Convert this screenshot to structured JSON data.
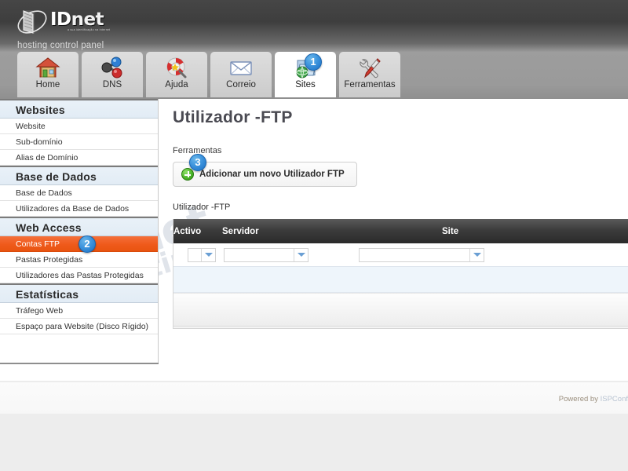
{
  "header": {
    "logo_text_1": "ID",
    "logo_text_2": "net",
    "logo_tagline": "a sua identificação na internet",
    "subtitle": "hosting control panel",
    "logo_icon": "idnet-swoosh-logo"
  },
  "tabs": [
    {
      "label": "Home",
      "icon": "house-icon",
      "active": false,
      "badge": ""
    },
    {
      "label": "DNS",
      "icon": "molecule-icon",
      "active": false,
      "badge": ""
    },
    {
      "label": "Ajuda",
      "icon": "lifering-magnifier-icon",
      "active": false,
      "badge": ""
    },
    {
      "label": "Correio",
      "icon": "envelope-icon",
      "active": false,
      "badge": ""
    },
    {
      "label": "Sites",
      "icon": "globe-folder-icon",
      "active": true,
      "badge": "1"
    },
    {
      "label": "Ferramentas",
      "icon": "wrench-screwdriver-icon",
      "active": false,
      "badge": ""
    }
  ],
  "sidebar": {
    "groups": [
      {
        "title": "Websites",
        "items": [
          {
            "label": "Website",
            "selected": false,
            "badge": ""
          },
          {
            "label": "Sub-domínio",
            "selected": false,
            "badge": ""
          },
          {
            "label": "Alias de Domínio",
            "selected": false,
            "badge": ""
          }
        ]
      },
      {
        "title": "Base de Dados",
        "items": [
          {
            "label": "Base de Dados",
            "selected": false,
            "badge": ""
          },
          {
            "label": "Utilizadores da Base de Dados",
            "selected": false,
            "badge": ""
          }
        ]
      },
      {
        "title": "Web Access",
        "items": [
          {
            "label": "Contas FTP",
            "selected": true,
            "badge": "2"
          },
          {
            "label": "Pastas Protegidas",
            "selected": false,
            "badge": ""
          },
          {
            "label": "Utilizadores das Pastas Protegidas",
            "selected": false,
            "badge": ""
          }
        ]
      },
      {
        "title": "Estatísticas",
        "items": [
          {
            "label": "Tráfego Web",
            "selected": false,
            "badge": ""
          },
          {
            "label": "Espaço para Website (Disco Rígido)",
            "selected": false,
            "badge": ""
          }
        ]
      }
    ]
  },
  "main": {
    "page_title": "Utilizador -FTP",
    "tools_label": "Ferramentas",
    "add_button_label": "Adicionar um novo Utilizador FTP",
    "add_button_badge": "3",
    "add_button_icon": "green-plus-icon",
    "list_caption": "Utilizador -FTP",
    "table": {
      "columns": [
        "Activo",
        "Servidor",
        "Site"
      ],
      "filters": {
        "activo_value": "",
        "servidor_value": "",
        "site_value": ""
      },
      "rows": []
    }
  },
  "footer": {
    "powered_prefix": "Powered by ",
    "powered_brand": "ISPConf"
  },
  "watermark": {
    "line1": "IDnet",
    "line2": "hosting"
  },
  "colors": {
    "accent_orange": "#ef5a1b",
    "badge_blue": "#3d94dd",
    "header_dark": "#3e3e3e",
    "tabbar_gray": "#9a9a9a",
    "table_header_dark": "#2a2a2a",
    "row_highlight": "#eef5fb"
  }
}
